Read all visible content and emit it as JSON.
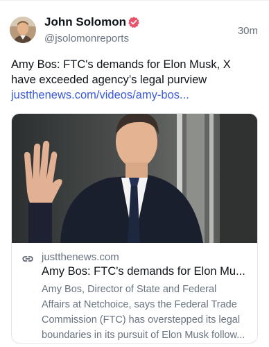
{
  "author": {
    "name": "John Solomon",
    "handle": "@jsolomonreports",
    "verified_icon": "verified-badge-icon",
    "badge_color": "#e8536c"
  },
  "post": {
    "time": "30m",
    "text_lines": [
      "Amy Bos: FTC's demands for Elon Musk, X",
      "have exceeded agency’s legal purview"
    ],
    "link_text": "justthenews.com/videos/amy-bos...",
    "link_color": "#3a5bd6"
  },
  "card": {
    "link_icon": "link-icon",
    "domain": "justthenews.com",
    "title": "Amy Bos: FTC's demands for Elon Mu...",
    "description_lines": [
      "Amy Bos, Director of State and Federal",
      "Affairs at Netchoice, says the Federal Trade",
      "Commission (FTC) has overstepped its legal",
      "boundaries in its pursuit of Elon Musk follow..."
    ]
  }
}
